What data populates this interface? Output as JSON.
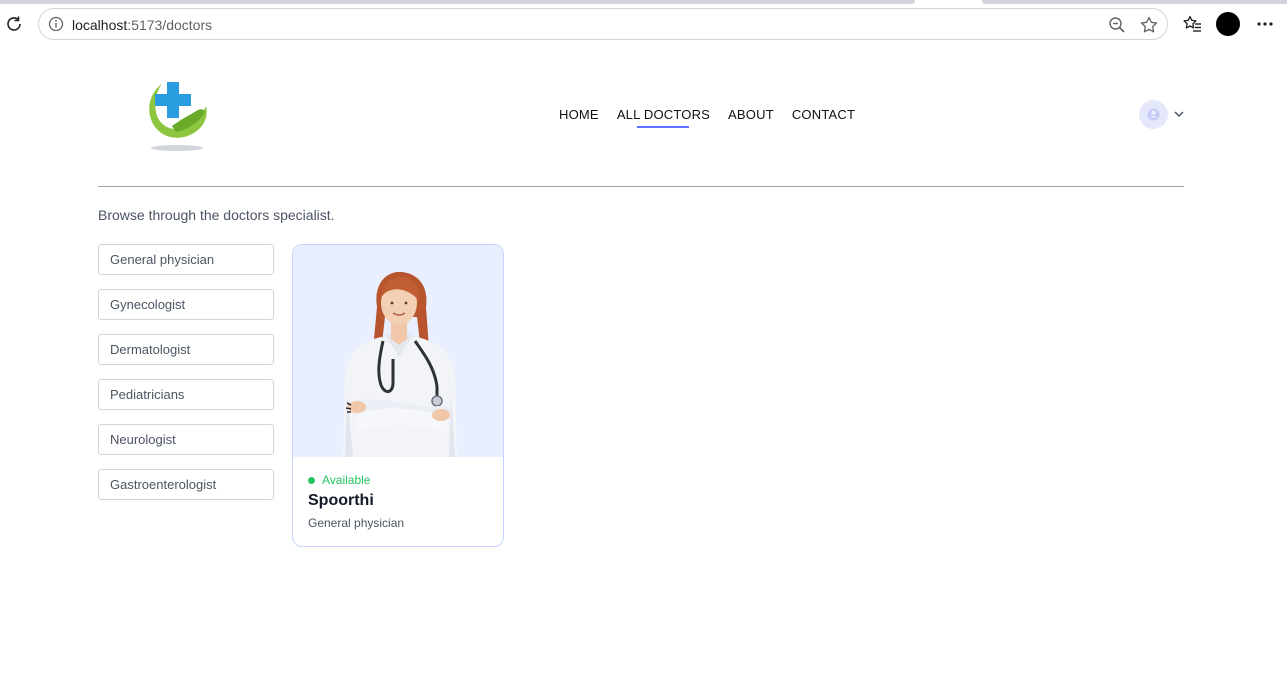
{
  "browser": {
    "url_host": "localhost",
    "url_path": ":5173/doctors"
  },
  "nav": {
    "items": [
      "HOME",
      "ALL DOCTORS",
      "ABOUT",
      "CONTACT"
    ],
    "active": "ALL DOCTORS"
  },
  "page": {
    "subtitle": "Browse through the doctors specialist."
  },
  "filters": [
    "General physician",
    "Gynecologist",
    "Dermatologist",
    "Pediatricians",
    "Neurologist",
    "Gastroenterologist"
  ],
  "doctors": [
    {
      "status": "Available",
      "name": "Spoorthi",
      "speciality": "General physician"
    }
  ],
  "colors": {
    "accent": "#5f6fff",
    "available": "#22c55e",
    "card_bg": "#eaefff"
  }
}
